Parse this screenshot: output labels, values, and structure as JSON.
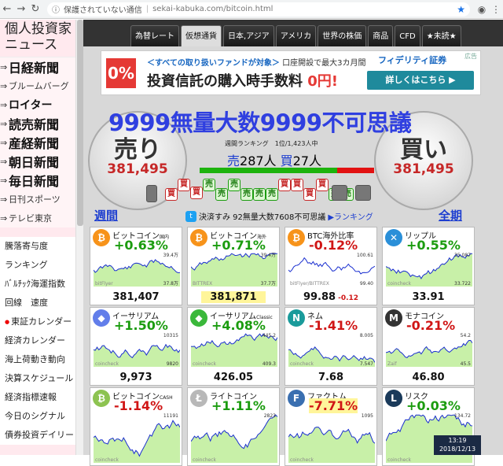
{
  "browser": {
    "security": "保護されていない通信",
    "separator": "|",
    "url": "sekai-kabuka.com/bitcoin.html"
  },
  "sidebar": {
    "title_line1": "個人投資家",
    "title_line2": "ニュース",
    "news_links": [
      {
        "label": "日経新聞",
        "size": "big"
      },
      {
        "label": "ブルームバーグ",
        "size": "sm"
      },
      {
        "label": "ロイター",
        "size": "mid"
      },
      {
        "label": "読売新聞",
        "size": "big"
      },
      {
        "label": "産経新聞",
        "size": "big"
      },
      {
        "label": "朝日新聞",
        "size": "big"
      },
      {
        "label": "毎日新聞",
        "size": "big"
      },
      {
        "label": "日刊スポーツ",
        "size": "sm"
      },
      {
        "label": "テレビ東京",
        "size": "sm"
      }
    ],
    "menu": [
      "騰落寄与度",
      "ランキング",
      "ﾊﾞﾙﾁｯｸ海運指数",
      "回線　速度",
      "東証カレンダー",
      "経済カレンダー",
      "海上荷動き動向",
      "決算スケジュール",
      "経済指標速報",
      "今日のシグナル",
      "債券投資デイリー"
    ]
  },
  "tabs": [
    "為替レート",
    "仮想通貨",
    "日本,アジア",
    "アメリカ",
    "世界の株価",
    "商品",
    "CFD",
    "★未読★"
  ],
  "active_tab": 1,
  "ad": {
    "badge": "0%",
    "line1_pre": "＜すべての取り扱いファンドが対象＞",
    "line1_post": "口座開設で最大3カ月間",
    "line2": "投資信託の購入時手数料 ",
    "line2_red": "0円!",
    "brand": "フィデリティ証券",
    "button": "詳しくはこちら ▶",
    "tag": "広告"
  },
  "ranking": {
    "banner": "9999無量大数9999不可思議",
    "sell_label": "売り",
    "buy_label": "買い",
    "sell_value": "381,495",
    "buy_value": "381,495",
    "weekly": "週間ランキング　1位/1,423人中",
    "sell_prefix": "売",
    "sell_count": "287人",
    "buy_prefix": "買",
    "buy_count": "27人",
    "sell_ratio": 0.79,
    "weekly_link": "週間",
    "period_link": "全期",
    "settled": "決済すみ 92無量大数7608不可思議",
    "ranking_link": "▶ランキング",
    "blocks": [
      "買",
      "買",
      "買",
      "売",
      "売",
      "売",
      "売",
      "売",
      "売",
      "買",
      "買",
      "買",
      "買",
      "売",
      "売"
    ]
  },
  "cards": [
    {
      "name": "ビットコイン",
      "tag": "国内",
      "change": "+0.63%",
      "dir": "up",
      "price": "381,407",
      "icon": "bitcoin-icon",
      "color": "#f7931a",
      "glyph": "₿",
      "src": "bitFlyer",
      "hi": "39.4万",
      "lo": "37.8万"
    },
    {
      "name": "ビットコイン",
      "tag": "海外",
      "change": "+0.71%",
      "dir": "up",
      "price": "381,871",
      "icon": "bitcoin-icon",
      "color": "#f7931a",
      "glyph": "₿",
      "src": "BITTREX",
      "hi": "39.4万",
      "lo": "37.7万",
      "hl_price": true
    },
    {
      "name": "BTC海外比率",
      "tag": "",
      "change": "-0.12%",
      "dir": "dn",
      "price": "99.88",
      "sub": "-0.12",
      "icon": "bitcoin-icon",
      "color": "#f7931a",
      "glyph": "₿",
      "src": "bitFlyer/BITTREX",
      "hi": "100.61",
      "lo": "99.40"
    },
    {
      "name": "リップル",
      "tag": "",
      "change": "+0.55%",
      "dir": "up",
      "price": "33.91",
      "icon": "ripple-icon",
      "color": "#2a8fd8",
      "glyph": "✕",
      "src": "coincheck",
      "hi": "35.087",
      "lo": "33.722"
    },
    {
      "name": "イーサリアム",
      "tag": "",
      "change": "+1.50%",
      "dir": "up",
      "price": "9,973",
      "icon": "ethereum-icon",
      "color": "#627eea",
      "glyph": "◆",
      "src": "coincheck",
      "hi": "10315",
      "lo": "9820"
    },
    {
      "name": "イーサリアム",
      "tag": "Classic",
      "change": "+4.08%",
      "dir": "up",
      "price": "426.05",
      "icon": "ethereum-classic-icon",
      "color": "#3ab83a",
      "glyph": "◆",
      "src": "coincheck",
      "hi": "445.2",
      "lo": "409.3"
    },
    {
      "name": "ネム",
      "tag": "",
      "change": "-1.41%",
      "dir": "dn",
      "price": "7.68",
      "icon": "nem-icon",
      "color": "#1a9b9b",
      "glyph": "N",
      "src": "coincheck",
      "hi": "8.005",
      "lo": "7.547"
    },
    {
      "name": "モナコイン",
      "tag": "",
      "change": "-0.21%",
      "dir": "dn",
      "price": "46.80",
      "icon": "monacoin-icon",
      "color": "#333333",
      "glyph": "M",
      "src": "Zaif",
      "hi": "54.2",
      "lo": "45.5"
    },
    {
      "name": "ビットコイン",
      "tag": "CASH",
      "change": "-1.14%",
      "dir": "dn",
      "price": "",
      "icon": "bitcoin-cash-icon",
      "color": "#8dc351",
      "glyph": "₿",
      "src": "coincheck",
      "hi": "11191",
      "lo": ""
    },
    {
      "name": "ライトコイン",
      "tag": "",
      "change": "+1.11%",
      "dir": "up",
      "price": "",
      "icon": "litecoin-icon",
      "color": "#b8b8b8",
      "glyph": "Ł",
      "src": "coincheck",
      "hi": "2823",
      "lo": ""
    },
    {
      "name": "ファクトム",
      "tag": "",
      "change": "-7.71%",
      "dir": "dn",
      "price": "",
      "icon": "factom-icon",
      "color": "#3a6fb0",
      "glyph": "F",
      "src": "coincheck",
      "hi": "1095",
      "lo": "",
      "hl_change": true
    },
    {
      "name": "リスク",
      "tag": "",
      "change": "+0.03%",
      "dir": "up",
      "price": "",
      "icon": "lisk-icon",
      "color": "#1a3a5a",
      "glyph": "L",
      "src": "coincheck",
      "hi": "134.72",
      "lo": ""
    }
  ],
  "clock": {
    "time": "13:19",
    "date": "2018/12/13"
  }
}
